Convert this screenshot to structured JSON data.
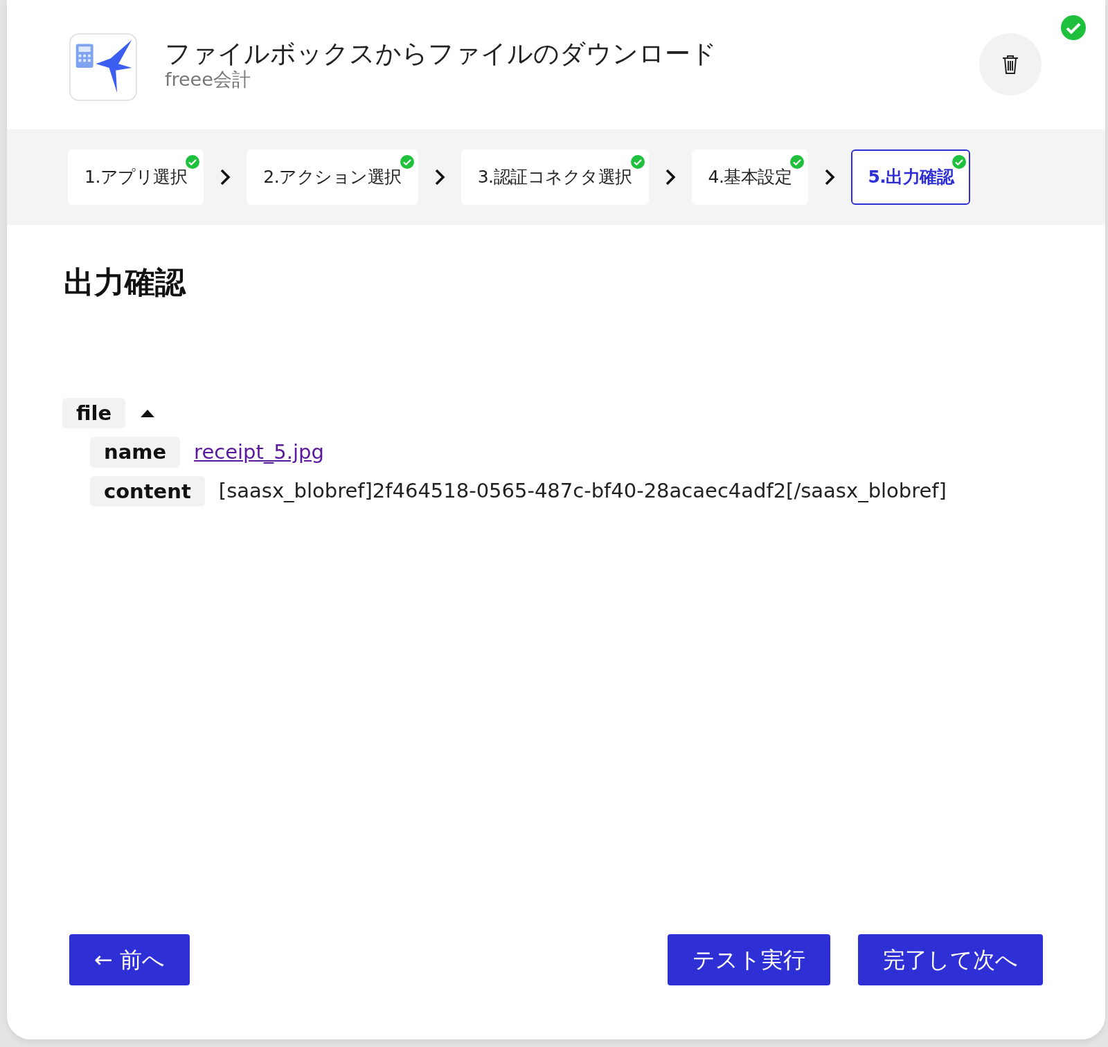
{
  "header": {
    "title": "ファイルボックスからファイルのダウンロード",
    "subtitle": "freee会計",
    "completed": true
  },
  "steps": [
    {
      "label": "1.アプリ選択",
      "done": true,
      "selected": false
    },
    {
      "label": "2.アクション選択",
      "done": true,
      "selected": false
    },
    {
      "label": "3.認証コネクタ選択",
      "done": true,
      "selected": false
    },
    {
      "label": "4.基本設定",
      "done": true,
      "selected": false
    },
    {
      "label": "5.出力確認",
      "done": true,
      "selected": true
    }
  ],
  "section_title": "出力確認",
  "output_tree": [
    {
      "key": "file",
      "expanded": true,
      "children": [
        {
          "key": "name",
          "value": "receipt_5.jpg",
          "kind": "link"
        },
        {
          "key": "content",
          "value": "[saasx_blobref]2f464518-0565-487c-bf40-28acaec4adf2[/saasx_blobref]",
          "kind": "text"
        }
      ]
    }
  ],
  "left_buttons": [
    {
      "label": "← 前へ"
    }
  ],
  "right_buttons": [
    {
      "label": "テスト実行"
    },
    {
      "label": "完了して次へ"
    }
  ]
}
